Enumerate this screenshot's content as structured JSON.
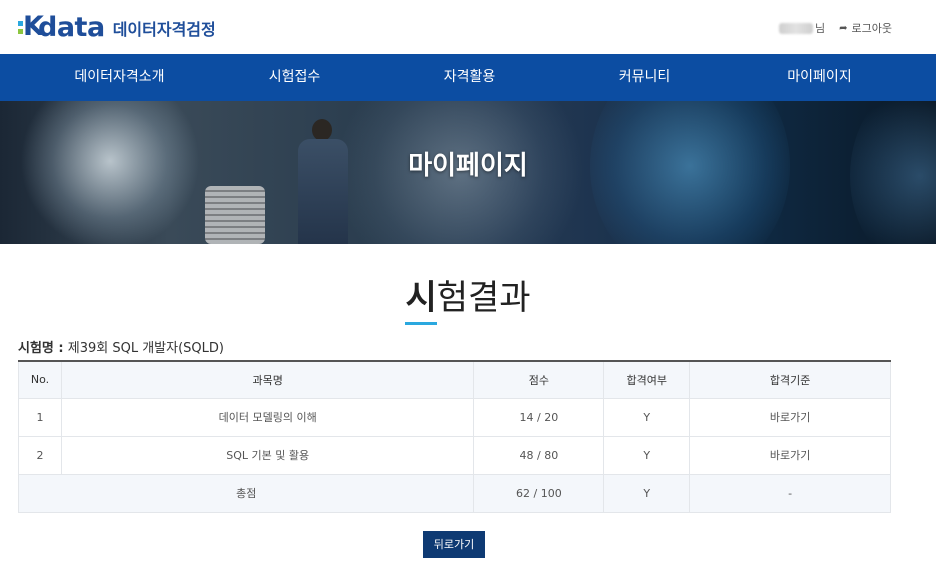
{
  "header": {
    "logo_main": "data",
    "logo_mark": "K",
    "logo_sub": "데이터자격검정",
    "user_suffix": "님",
    "logout_label": "로그아웃",
    "logout_icon": "logout-icon"
  },
  "nav": {
    "items": [
      {
        "label": "데이터자격소개"
      },
      {
        "label": "시험접수"
      },
      {
        "label": "자격활용"
      },
      {
        "label": "커뮤니티"
      },
      {
        "label": "마이페이지"
      }
    ]
  },
  "banner": {
    "title": "마이페이지"
  },
  "page": {
    "title_first": "시",
    "title_rest": "험결과",
    "exam_label": "시험명 :",
    "exam_value": "제39회 SQL 개발자(SQLD)"
  },
  "table": {
    "headers": [
      "No.",
      "과목명",
      "점수",
      "합격여부",
      "합격기준"
    ],
    "rows": [
      {
        "no": "1",
        "subject": "데이터 모델링의 이해",
        "score": "14 / 20",
        "pass": "Y",
        "criteria": "바로가기"
      },
      {
        "no": "2",
        "subject": "SQL 기본 및 활용",
        "score": "48 / 80",
        "pass": "Y",
        "criteria": "바로가기"
      }
    ],
    "total": {
      "label": "총점",
      "score": "62 / 100",
      "pass": "Y",
      "criteria": "-"
    }
  },
  "actions": {
    "back_label": "뒤로가기"
  },
  "colors": {
    "nav_bg": "#0c4da2",
    "brand": "#1f4e9a",
    "accent": "#2aa8df",
    "button_bg": "#0e3a73"
  }
}
